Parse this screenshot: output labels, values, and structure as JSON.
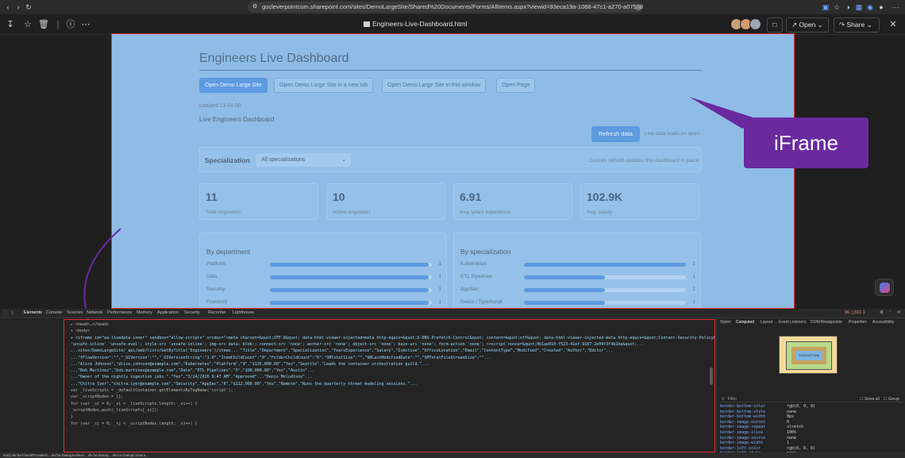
{
  "browser": {
    "url": "gocleverpointcom.sharepoint.com/sites/DemoLargeSite/Shared%20Documents/Forms/AllItems.aspx?viewid=93eca19a-1068-47c1-a270-a07538806eb88..."
  },
  "viewer": {
    "file_title": "Engineers-Live-Dashboard.html",
    "open_label": "Open",
    "share_label": "Share"
  },
  "dashboard": {
    "title": "Engineers Live Dashboard",
    "buttons": [
      "Open Demo Large Site",
      "Open Demo Large Site in a new tab",
      "Open Demo Large Site in this window",
      "Open Page"
    ],
    "loaded": "Loaded 13:44:00",
    "subtitle": "Live Engineers Dashboard",
    "refresh_label": "Refresh data",
    "refresh_note": "Live data loads on open.",
    "filter_label": "Specialization",
    "filter_value": "All specializations",
    "filter_note": "Custom refresh updates this dashboard in place.",
    "stats": [
      {
        "value": "11",
        "label": "Total engineers"
      },
      {
        "value": "10",
        "label": "Active engineers"
      },
      {
        "value": "6.91",
        "label": "Avg. years experience"
      },
      {
        "value": "102.9K",
        "label": "Avg. salary"
      }
    ],
    "by_department": {
      "title": "By department",
      "rows": [
        {
          "name": "Platform",
          "count": 1,
          "fraction": 0.98
        },
        {
          "name": "Data",
          "count": 1,
          "fraction": 0.98
        },
        {
          "name": "Security",
          "count": 1,
          "fraction": 0.98
        },
        {
          "name": "Frontend",
          "count": 1,
          "fraction": 0.98
        }
      ]
    },
    "by_specialization": {
      "title": "By specialization",
      "rows": [
        {
          "name": "Kubernetes",
          "count": 2,
          "fraction": 1.0
        },
        {
          "name": "ETL Pipelines",
          "count": 1,
          "fraction": 0.5
        },
        {
          "name": "AppSec",
          "count": 1,
          "fraction": 0.5
        },
        {
          "name": "React / TypeScript",
          "count": 1,
          "fraction": 0.5
        }
      ]
    }
  },
  "callout": {
    "text": "iFrame"
  },
  "devtools": {
    "tabs": [
      "Elements",
      "Console",
      "Sources",
      "Network",
      "Performance",
      "Memory",
      "Application",
      "Security",
      "Recorder",
      "Lighthouse"
    ],
    "right_tabs": [
      "Styles",
      "Computed",
      "Layout",
      "Event Listeners",
      "DOM Breakpoints",
      "Properties",
      "Accessibility"
    ],
    "counts": "96 △310 1",
    "code_lines": [
      "▸ <head>…</head>",
      "▾ <body>",
      "  ▾ <iframe id=\"ea-livedata-inner\" sandbox=\"allow-scripts\" srcdoc=\"<meta charset=&quot;UTF-8&quot; data-html-viewer-injected=meta http-equiv=&quot;X-DNS-Prefetch-Control&quot; content=&quot;off&quot; data-html-viewer-injected-meta http-equiv=&quot;Content-Security-Policy&quot;...",
      "'unsafe-inline' 'unsafe-eval'; style-src 'unsafe-inline'; img-src data: blob:; connect-src 'none'; worker-src 'none'; object-src 'none'; base-uri 'none'; form-action 'none'; ><script nonce=&quot;0b1ae010-f523-41ef-9107-2e09f3f4b1ba&quot;...",
      "...sites/DemoLargeSite/_api/web/lists/GetByTitle('Engineers')/items... \"Title\",\"Department\",\"Specialization\",\"YearsExperience\",\"Salary\",\"IsActive\",\"OfficeLocation\",\"Email\",\"ContentType\",\"Modified\",\"Created\",\"Author\",\"Editor\"...",
      "...\"fFlowVersion\":\"\",\"_UIVersion\":\"\",\"_UIVersionString\":\"1.0\",\"ItemChildCount\":\"0\",\"FolderChildCount\":\"0\",\"SMTotalSize\":\"\",\"SMLastModifiedDate\":\"\",\"SMTotalFileStreamSize\":\"\"...",
      "...\"Alice Johnson\",\"alice.johnson@example.com\",\"Kubernetes\",\"Platform\",\"9\",\"$135,000.00\",\"Yes\",\"Seattle\",\"Leads the container orchestration guild.\"...",
      "...\"Bob Martinez\",\"bob.martinez@example.com\",\"Data\",\"ETL Pipelines\",\"5\",\"$98,000.00\",\"Yes\",\"Austin\"...",
      "...\"Owner of the nightly ingestion jobs.\",\"Yes\",\"3/24/2026 9:47 AM\",\"Approved\"...\"Denis Molodtsov\"...",
      "...\"Chitra Iyer\",\"chitra.iyer@example.com\",\"Security\",\"AppSec\",\"6\",\"$112,000.00\",\"Yes\",\"Remote\",\"Runs the quarterly threat modeling sessions.\"...",
      "        var _liveScripts = _defaultContainer.getElementsByTagName('script');",
      "        var _scriptNodes = [];",
      "        for (var _si = 0; _si < _liveScripts.length; _si++) {",
      "          _scriptNodes.push(_liveScripts[_si]);",
      "        }",
      "        for (var _sj = 0; _sj < _scriptNodes.length; _sj++) {"
    ],
    "css_rows": [
      {
        "k": "border-bottom-color",
        "v": "rgb(0, 0, 0)"
      },
      {
        "k": "border-bottom-style",
        "v": "none"
      },
      {
        "k": "border-bottom-width",
        "v": "0px"
      },
      {
        "k": "border-image-outset",
        "v": "0"
      },
      {
        "k": "border-image-repeat",
        "v": "stretch"
      },
      {
        "k": "border-image-slice",
        "v": "100%"
      },
      {
        "k": "border-image-source",
        "v": "none"
      },
      {
        "k": "border-image-width",
        "v": "1"
      },
      {
        "k": "border-left-color",
        "v": "rgb(0, 0, 0)"
      },
      {
        "k": "border-left-style",
        "v": "none"
      }
    ],
    "filter_placeholder": "Filter",
    "show_all": "Show all",
    "group": "Group",
    "boxmodel_content": "1024×627.656"
  },
  "statusbar": "body  div.fui-FluentProvider2...  div.fui-DialogSurface...  div.fui-Dialog...  div.fui-DialogContent...",
  "colors": {
    "accent": "#5d9ae0",
    "callout": "#6a2a9e",
    "highlight": "#e03030"
  }
}
